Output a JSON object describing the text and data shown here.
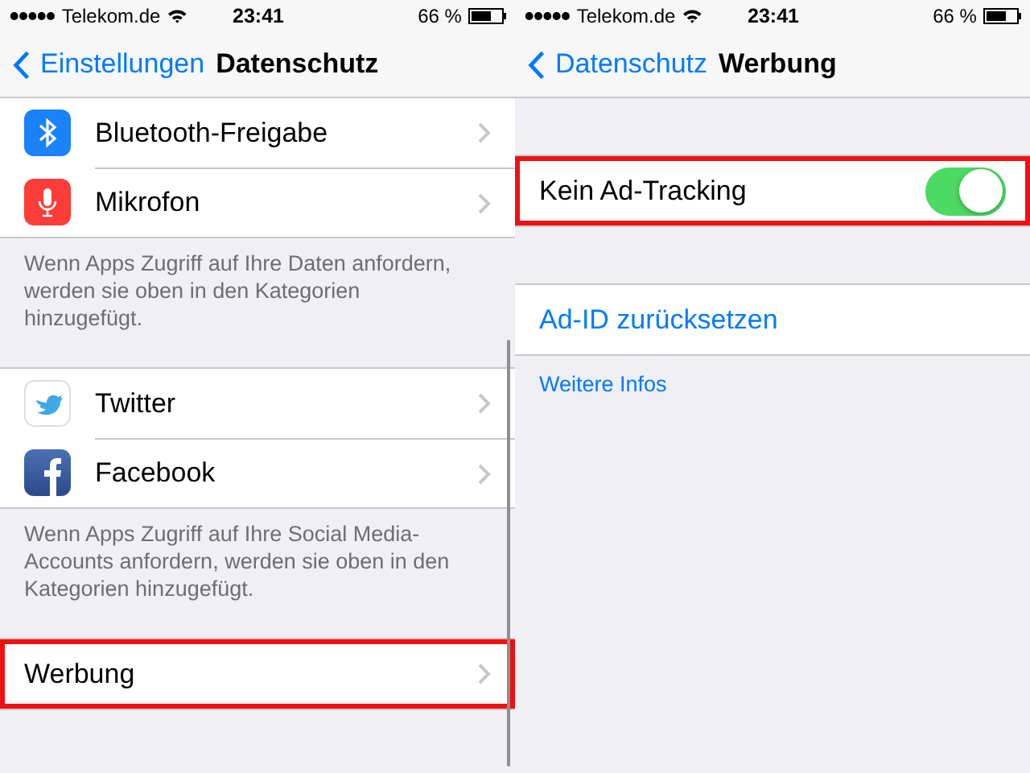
{
  "screens": [
    {
      "status_bar": {
        "carrier": "Telekom.de",
        "time": "23:41",
        "battery": "66 %"
      },
      "nav": {
        "back": "Einstellungen",
        "title": "Datenschutz"
      },
      "scrolled": true,
      "groups": [
        {
          "items": [
            {
              "kind": "app_link",
              "label": "Bluetooth-Freigabe",
              "highlighted": false
            },
            {
              "kind": "app_link",
              "label": "Mikrofon",
              "highlighted": false
            }
          ],
          "footer": {
            "kind": "note",
            "text": "Wenn Apps Zugriff auf Ihre Daten anfordern, werden sie oben in den Kategorien hinzugefügt."
          }
        },
        {
          "items": [
            {
              "kind": "app_link",
              "label": "Twitter",
              "highlighted": false
            },
            {
              "kind": "app_link",
              "label": "Facebook",
              "highlighted": false
            }
          ],
          "footer": {
            "kind": "note",
            "text": "Wenn Apps Zugriff auf Ihre Social Media-Accounts anfordern, werden sie oben in den Kategorien hinzugefügt."
          }
        },
        {
          "items": [
            {
              "kind": "link",
              "label": "Werbung",
              "highlighted": true
            }
          ]
        }
      ]
    },
    {
      "status_bar": {
        "carrier": "Telekom.de",
        "time": "23:41",
        "battery": "66 %"
      },
      "nav": {
        "back": "Datenschutz",
        "title": "Werbung"
      },
      "scrolled": false,
      "groups": [
        {
          "items": [
            {
              "kind": "toggle",
              "label": "Kein Ad-Tracking",
              "on": true,
              "highlighted": true
            }
          ]
        },
        {
          "items": [
            {
              "kind": "action",
              "label": "Ad-ID zurücksetzen",
              "highlighted": false
            }
          ],
          "footer": {
            "kind": "link",
            "text": "Weitere Infos"
          }
        }
      ]
    }
  ]
}
